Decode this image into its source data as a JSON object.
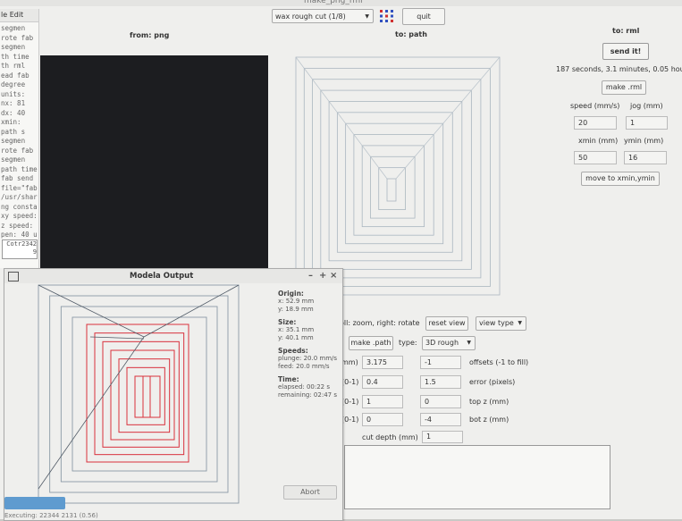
{
  "window_title": "make_png_rml",
  "terminal": {
    "menu": "le  Edit",
    "lines": [
      "segmen",
      "rote fab",
      "segmen",
      "th time",
      "th rml",
      "ead fab",
      "degree",
      "units:",
      "nx: 81",
      "dx: 40",
      "xmin:",
      "path s",
      "segmen",
      "rote fab",
      "segmen",
      "path time",
      "fab send",
      "file=\"fab",
      "/usr/shar",
      "ng consta",
      "xy speed:",
      "z speed:",
      "pen: 40 u"
    ],
    "input_lines": [
      "Cotr2342",
      "9"
    ]
  },
  "toolbar": {
    "mode_select": "wax rough cut (1/8)",
    "quit": "quit"
  },
  "headers": {
    "from": "from: png",
    "to_path": "to: path",
    "to_rml": "to: rml"
  },
  "rml": {
    "send": "send it!",
    "time_estimate": "187 seconds, 3.1 minutes, 0.05 hours",
    "make_rml": "make .rml",
    "speed_label": "speed (mm/s)",
    "jog_label": "jog (mm)",
    "speed_value": "20",
    "jog_value": "1",
    "xmin_label": "xmin (mm)",
    "ymin_label": "ymin (mm)",
    "xmin_value": "50",
    "ymin_value": "16",
    "move_button": "move to xmin,ymin"
  },
  "path_panel": {
    "hint": "oll: zoom, right: rotate",
    "reset_view": "reset view",
    "view_type": "view type",
    "make_path": "make .path",
    "type_label": "type:",
    "type_value": "3D rough",
    "rows": [
      {
        "prefix": "mm)",
        "v1": "3.175",
        "v2": "-1",
        "label": "offsets (-1 to fill)"
      },
      {
        "prefix": "(0-1)",
        "v1": "0.4",
        "v2": "1.5",
        "label": "error (pixels)"
      },
      {
        "prefix": "(0-1)",
        "v1": "1",
        "v2": "0",
        "label": "top z (mm)"
      },
      {
        "prefix": "(0-1)",
        "v1": "0",
        "v2": "-4",
        "label": "bot z (mm)"
      }
    ],
    "cut_depth_label": "cut depth (mm)",
    "cut_depth_value": "1"
  },
  "modela": {
    "title": "Modela Output",
    "minimize": "–",
    "maximize": "+",
    "close": "×",
    "origin_head": "Origin:",
    "origin_x": "x: 52.9 mm",
    "origin_y": "y: 18.9 mm",
    "size_head": "Size:",
    "size_x": "x: 35.1 mm",
    "size_y": "y: 40.1 mm",
    "speeds_head": "Speeds:",
    "plunge": "plunge: 20.0 mm/s",
    "feed": "feed: 20.0 mm/s",
    "time_head": "Time:",
    "elapsed": "elapsed: 00:22 s",
    "remaining": "remaining: 02:47 s",
    "abort": "Abort",
    "status": "Executing: 22344 2131 (0.56)",
    "progress": 0.18
  },
  "colors": {
    "cut_red": "#d8303c",
    "path_gray": "#8a9aa6",
    "canvas_dark": "#1c1d20"
  }
}
